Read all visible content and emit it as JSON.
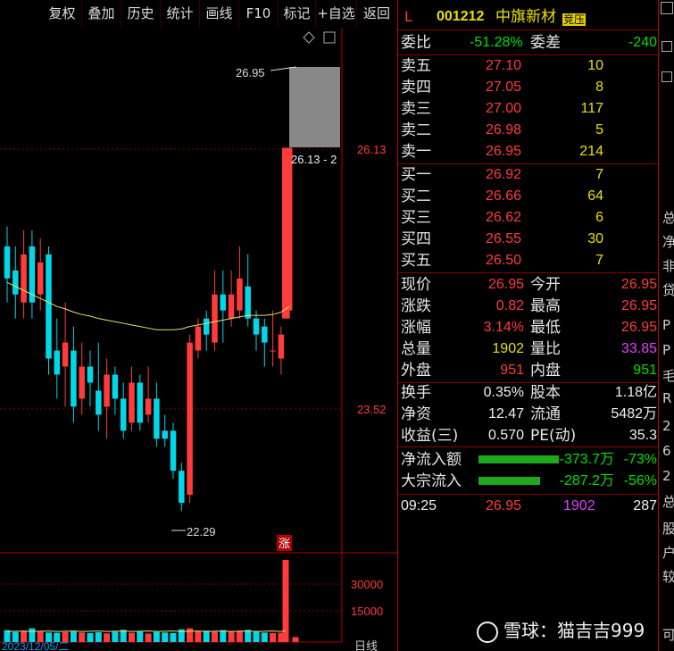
{
  "toolbar": {
    "tabs": [
      "复权",
      "叠加",
      "历史",
      "统计",
      "画线",
      "F10",
      "标记",
      "+自选",
      "返回"
    ]
  },
  "chart": {
    "high_marker": "26.95",
    "low_marker": "22.29",
    "price_axis_top": "26.13",
    "price_axis_mid": "23.52",
    "tooltip": "26.13 - 2",
    "zhang_badge": "涨",
    "volume_axis_top": "30000",
    "volume_axis_mid": "15000",
    "date_label": "2023/12/05/二",
    "period_label": "日线",
    "icons": [
      "diamond-icon",
      "square-icon"
    ]
  },
  "chart_data": {
    "type": "candlestick",
    "visible_price_labels": [
      "26.13",
      "23.52",
      "26.95",
      "22.29"
    ],
    "candles": [
      {
        "o": 24.9,
        "c": 24.5,
        "h": 25.15,
        "l": 24.2
      },
      {
        "o": 24.6,
        "c": 24.3,
        "h": 24.9,
        "l": 24.0
      },
      {
        "o": 24.2,
        "c": 24.8,
        "h": 25.1,
        "l": 24.0
      },
      {
        "o": 24.9,
        "c": 24.2,
        "h": 25.1,
        "l": 24.0
      },
      {
        "o": 24.3,
        "c": 24.7,
        "h": 25.0,
        "l": 24.1
      },
      {
        "o": 24.8,
        "c": 23.5,
        "h": 24.9,
        "l": 23.3
      },
      {
        "o": 23.6,
        "c": 23.3,
        "h": 24.0,
        "l": 23.0
      },
      {
        "o": 23.4,
        "c": 23.7,
        "h": 24.2,
        "l": 22.9
      },
      {
        "o": 23.6,
        "c": 22.9,
        "h": 23.9,
        "l": 22.7
      },
      {
        "o": 23.0,
        "c": 23.4,
        "h": 23.7,
        "l": 22.8
      },
      {
        "o": 23.4,
        "c": 23.2,
        "h": 23.6,
        "l": 22.9
      },
      {
        "o": 23.1,
        "c": 22.8,
        "h": 23.7,
        "l": 22.6
      },
      {
        "o": 22.9,
        "c": 23.3,
        "h": 23.5,
        "l": 22.5
      },
      {
        "o": 23.3,
        "c": 23.0,
        "h": 23.4,
        "l": 22.8
      },
      {
        "o": 23.0,
        "c": 22.6,
        "h": 23.2,
        "l": 22.5
      },
      {
        "o": 22.7,
        "c": 23.2,
        "h": 23.4,
        "l": 22.6
      },
      {
        "o": 23.2,
        "c": 22.7,
        "h": 23.3,
        "l": 22.6
      },
      {
        "o": 22.8,
        "c": 23.0,
        "h": 23.4,
        "l": 22.7
      },
      {
        "o": 23.0,
        "c": 22.5,
        "h": 23.2,
        "l": 22.4
      },
      {
        "o": 22.6,
        "c": 22.5,
        "h": 22.8,
        "l": 22.4
      },
      {
        "o": 22.6,
        "c": 22.1,
        "h": 22.7,
        "l": 22.0
      },
      {
        "o": 22.1,
        "c": 21.7,
        "h": 22.2,
        "l": 21.6
      },
      {
        "o": 21.8,
        "c": 23.7,
        "h": 23.8,
        "l": 21.7
      },
      {
        "o": 23.6,
        "c": 23.9,
        "h": 24.0,
        "l": 23.5
      },
      {
        "o": 24.0,
        "c": 23.8,
        "h": 24.1,
        "l": 23.6
      },
      {
        "o": 23.7,
        "c": 24.3,
        "h": 24.6,
        "l": 23.6
      },
      {
        "o": 24.3,
        "c": 24.1,
        "h": 24.6,
        "l": 23.7
      },
      {
        "o": 24.0,
        "c": 24.3,
        "h": 24.6,
        "l": 23.9
      },
      {
        "o": 24.1,
        "c": 24.5,
        "h": 24.9,
        "l": 24.0
      },
      {
        "o": 24.4,
        "c": 24.0,
        "h": 24.8,
        "l": 23.9
      },
      {
        "o": 24.0,
        "c": 23.8,
        "h": 24.1,
        "l": 23.6
      },
      {
        "o": 23.9,
        "c": 23.7,
        "h": 24.0,
        "l": 23.4
      },
      {
        "o": 23.6,
        "c": 23.6,
        "h": 24.1,
        "l": 23.4
      },
      {
        "o": 23.5,
        "c": 23.8,
        "h": 23.9,
        "l": 23.3
      },
      {
        "o": 24.1,
        "c": 26.13,
        "h": 26.13,
        "l": 24.0
      }
    ],
    "ma": [
      24.45,
      24.4,
      24.35,
      24.3,
      24.25,
      24.2,
      24.15,
      24.12,
      24.08,
      24.05,
      24.03,
      24.0,
      23.98,
      23.96,
      23.94,
      23.92,
      23.9,
      23.88,
      23.86,
      23.86,
      23.86,
      23.87,
      23.9,
      23.92,
      23.94,
      23.96,
      23.98,
      24.0,
      24.02,
      24.04,
      24.04,
      24.04,
      24.05,
      24.08,
      24.15
    ],
    "volumes": [
      4500,
      3800,
      4200,
      5200,
      3900,
      3600,
      3500,
      3800,
      4000,
      3600,
      3400,
      3700,
      3300,
      3900,
      4600,
      3500,
      3900,
      3200,
      3800,
      3600,
      3400,
      4800,
      5200,
      4100,
      4300,
      3900,
      4500,
      4000,
      4300,
      4600,
      3900,
      3600,
      3400,
      3500,
      31000,
      1902
    ],
    "vol_ylim": [
      0,
      33000
    ]
  },
  "quote": {
    "code_prefix": "L",
    "code": "001212",
    "name": "中旗新材",
    "auction_badge": "竞压",
    "weibi_label": "委比",
    "weibi_value": "-51.28%",
    "weicha_label": "委差",
    "weicha_value": "-240",
    "asks": [
      {
        "label": "卖五",
        "price": "27.10",
        "vol": "10"
      },
      {
        "label": "卖四",
        "price": "27.05",
        "vol": "8"
      },
      {
        "label": "卖三",
        "price": "27.00",
        "vol": "117"
      },
      {
        "label": "卖二",
        "price": "26.98",
        "vol": "5"
      },
      {
        "label": "卖一",
        "price": "26.95",
        "vol": "214"
      }
    ],
    "bids": [
      {
        "label": "买一",
        "price": "26.92",
        "vol": "7"
      },
      {
        "label": "买二",
        "price": "26.66",
        "vol": "64"
      },
      {
        "label": "买三",
        "price": "26.62",
        "vol": "6"
      },
      {
        "label": "买四",
        "price": "26.55",
        "vol": "30"
      },
      {
        "label": "买五",
        "price": "26.50",
        "vol": "7"
      }
    ],
    "stats": [
      {
        "l1": "现价",
        "v1": "26.95",
        "c1": "red",
        "l2": "今开",
        "v2": "26.95",
        "c2": "red"
      },
      {
        "l1": "涨跌",
        "v1": "0.82",
        "c1": "red",
        "l2": "最高",
        "v2": "26.95",
        "c2": "red"
      },
      {
        "l1": "涨幅",
        "v1": "3.14%",
        "c1": "red",
        "l2": "最低",
        "v2": "26.95",
        "c2": "red"
      },
      {
        "l1": "总量",
        "v1": "1902",
        "c1": "yellow",
        "l2": "量比",
        "v2": "33.85",
        "c2": "purple"
      },
      {
        "l1": "外盘",
        "v1": "951",
        "c1": "red",
        "l2": "内盘",
        "v2": "951",
        "c2": "green"
      }
    ],
    "fund": [
      {
        "l1": "换手",
        "v1": "0.35%",
        "l2": "股本",
        "v2": "1.18亿"
      },
      {
        "l1": "净资",
        "v1": "12.47",
        "l2": "流通",
        "v2": "5482万"
      },
      {
        "l1": "收益(三)",
        "v1": "0.570",
        "l2": "PE(动)",
        "v2": "35.3"
      }
    ],
    "flows": [
      {
        "label": "净流入额",
        "amount": "-373.7万",
        "pct": "-73%",
        "fill": 0.73
      },
      {
        "label": "大宗流入",
        "amount": "-287.2万",
        "pct": "-56%",
        "fill": 0.56
      }
    ],
    "tick": {
      "time": "09:25",
      "price": "26.95",
      "vol": "1902",
      "count": "287"
    }
  },
  "strip": [
    "总",
    "净",
    "非",
    "贷",
    "P",
    "P",
    "毛",
    "R",
    "2",
    "6",
    "2",
    "总",
    "股",
    "户",
    "较",
    "可"
  ],
  "watermark": "雪球：猫吉吉999"
}
